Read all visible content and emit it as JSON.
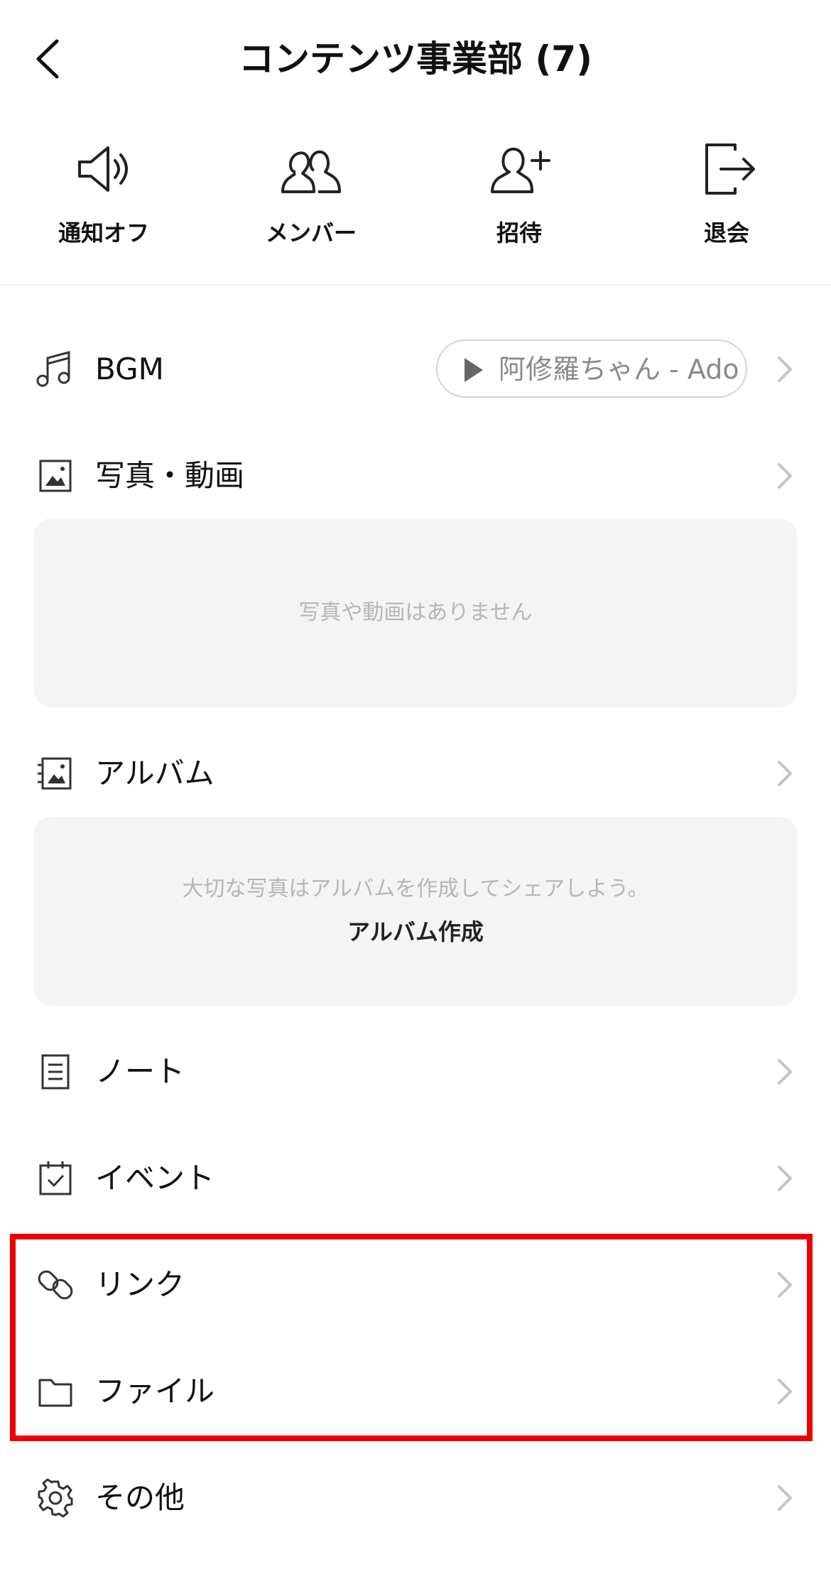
{
  "header": {
    "title": "コンテンツ事業部 (7)"
  },
  "actions": [
    {
      "label": "通知オフ",
      "icon": "speaker-icon"
    },
    {
      "label": "メンバー",
      "icon": "members-icon"
    },
    {
      "label": "招待",
      "icon": "add-person-icon"
    },
    {
      "label": "退会",
      "icon": "leave-icon"
    }
  ],
  "menu": {
    "bgm": {
      "label": "BGM",
      "track": "阿修羅ちゃん - Ado"
    },
    "photos": {
      "label": "写真・動画",
      "empty": "写真や動画はありません"
    },
    "album": {
      "label": "アルバム",
      "empty": "大切な写真はアルバムを作成してシェアしよう。",
      "create": "アルバム作成"
    },
    "note": {
      "label": "ノート"
    },
    "event": {
      "label": "イベント"
    },
    "link": {
      "label": "リンク"
    },
    "file": {
      "label": "ファイル"
    },
    "other": {
      "label": "その他"
    }
  },
  "colors": {
    "highlight": "#ee0000",
    "empty_box": "#f4f4f4",
    "chevron": "#c4c4c4"
  }
}
